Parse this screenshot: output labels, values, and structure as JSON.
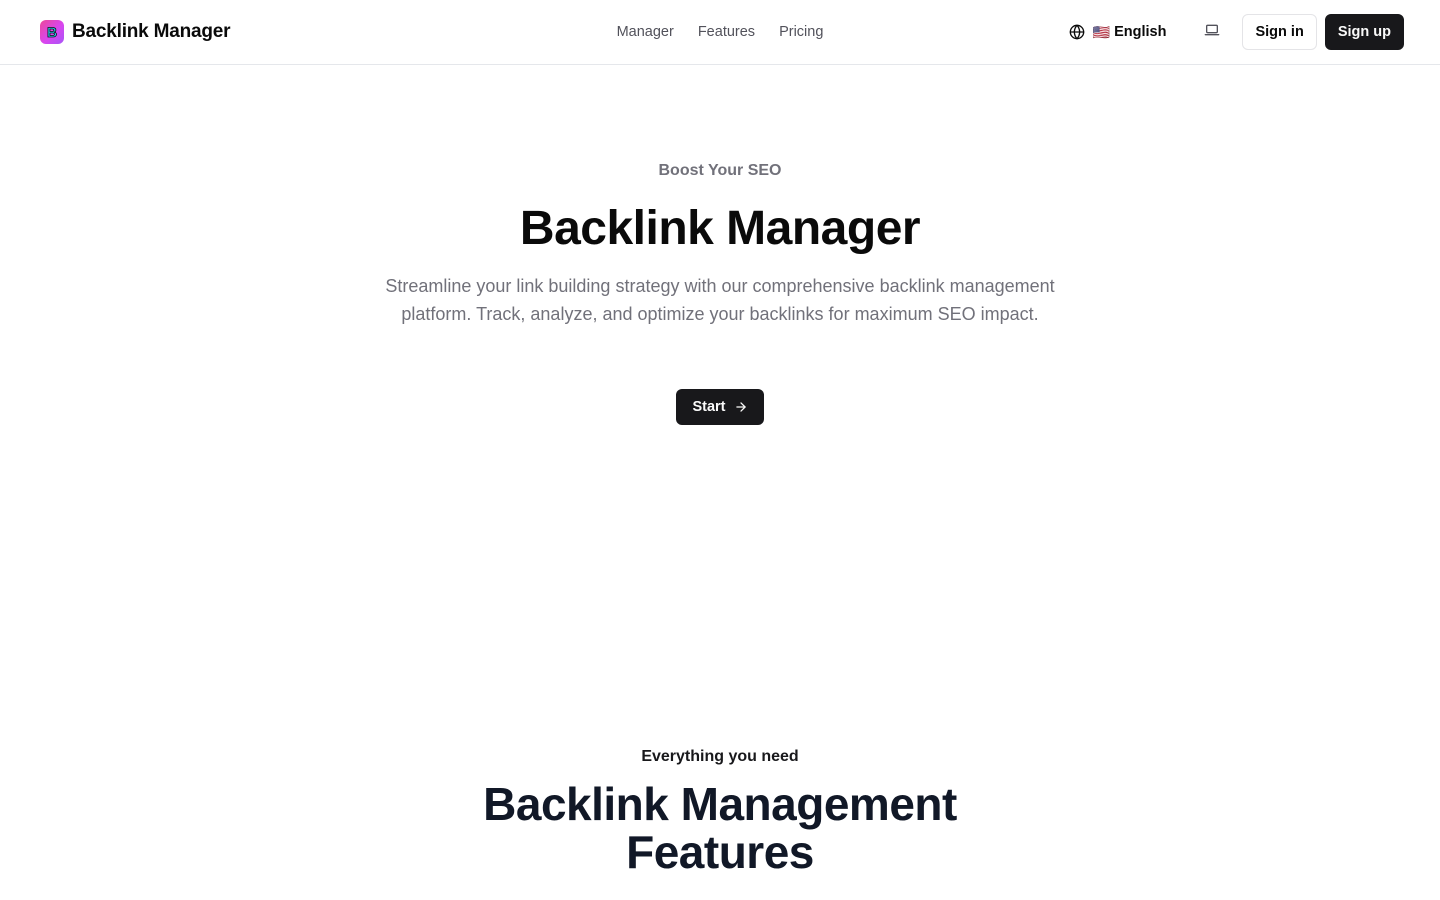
{
  "header": {
    "brand_name": "Backlink Manager",
    "logo_letter": "B",
    "nav": [
      {
        "label": "Manager"
      },
      {
        "label": "Features"
      },
      {
        "label": "Pricing"
      }
    ],
    "language": {
      "flag": "🇺🇸",
      "label": "English"
    },
    "sign_in_label": "Sign in",
    "sign_up_label": "Sign up"
  },
  "hero": {
    "eyebrow": "Boost Your SEO",
    "title": "Backlink Manager",
    "description": "Streamline your link building strategy with our comprehensive backlink management platform. Track, analyze, and optimize your backlinks for maximum SEO impact.",
    "cta_label": "Start"
  },
  "features": {
    "eyebrow": "Everything you need",
    "title": "Backlink Management Features"
  },
  "colors": {
    "primary": "#18181b",
    "muted_text": "#71717a",
    "border": "#e5e7eb",
    "logo_gradient_start": "#ec4899",
    "logo_gradient_end": "#a855f7",
    "logo_letter": "#22d3ee"
  }
}
